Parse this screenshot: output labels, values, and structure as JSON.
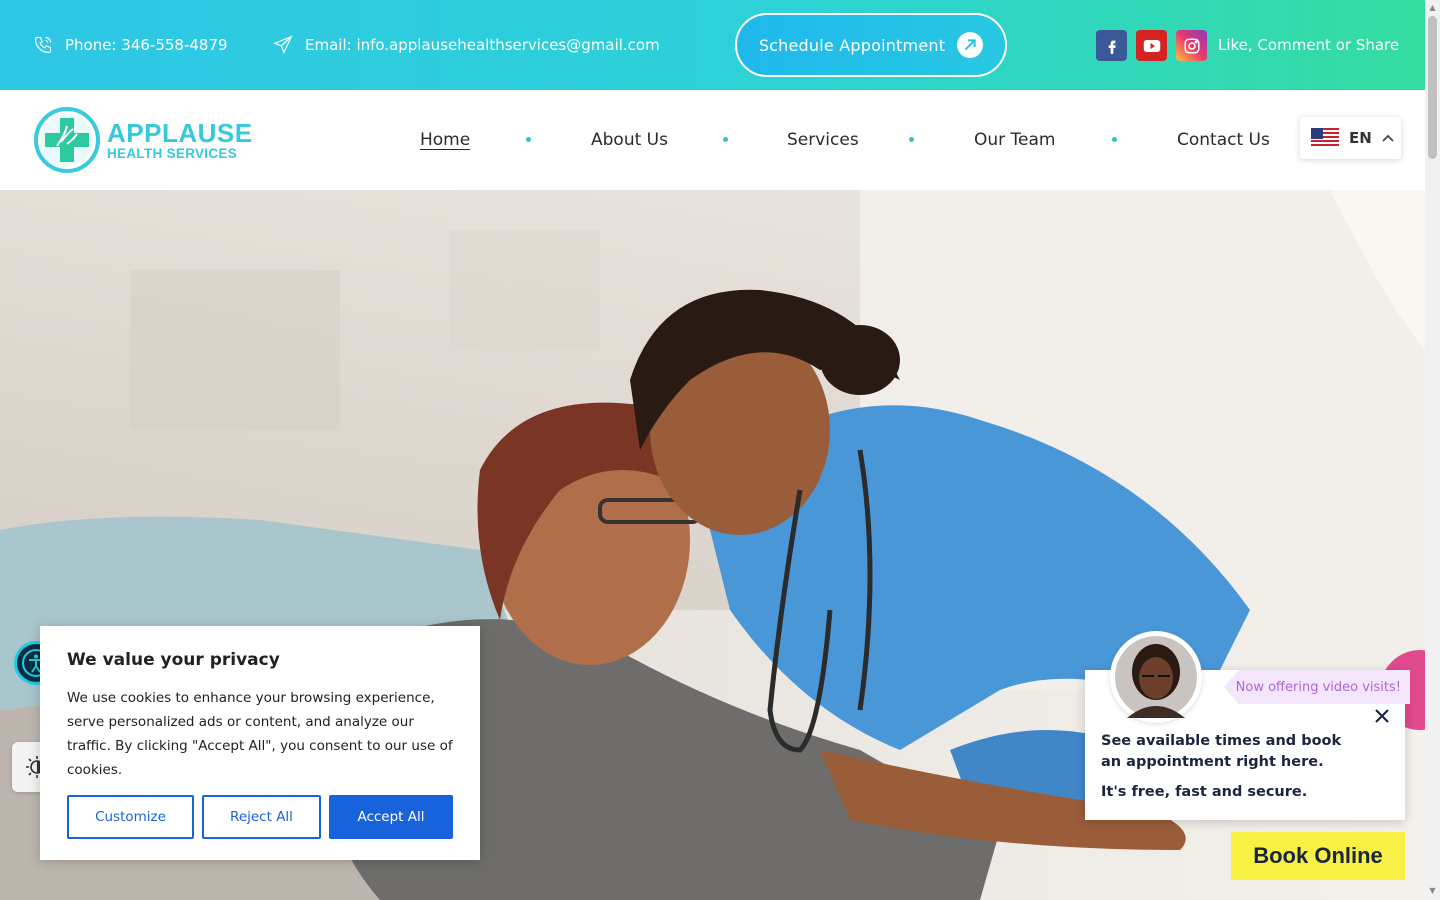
{
  "topbar": {
    "phone": "Phone: 346-558-4879",
    "email": "Email: info.applausehealthservices@gmail.com",
    "schedule_label": "Schedule Appointment",
    "share_text": "Like, Comment or Share",
    "icons": [
      "phone-icon",
      "paper-plane-icon",
      "arrow-icon",
      "facebook-icon",
      "youtube-icon",
      "instagram-icon"
    ],
    "gradient": [
      "#2ec6e6",
      "#34dca0"
    ]
  },
  "logo": {
    "line1": "APPLAUSE",
    "line2": "HEALTH SERVICES",
    "color": "#34c9dd"
  },
  "nav": {
    "items": [
      {
        "label": "Home",
        "active": true
      },
      {
        "label": "About Us"
      },
      {
        "label": "Services"
      },
      {
        "label": "Our Team"
      },
      {
        "label": "Contact Us"
      }
    ],
    "language": "EN",
    "accent": "#2ec6c8"
  },
  "cookie": {
    "title": "We value your privacy",
    "body": "We use cookies to enhance your browsing experience, serve personalized ads or content, and analyze our traffic. By clicking \"Accept All\", you consent to our use of cookies.",
    "customize": "Customize",
    "reject": "Reject All",
    "accept": "Accept All",
    "brand_color": "#1863dc"
  },
  "booking": {
    "banner": "Now offering video visits!",
    "line1": "See available times and book an appointment right here.",
    "line2": "It's free, fast and secure.",
    "button": "Book Online",
    "button_color": "#f7f145"
  }
}
